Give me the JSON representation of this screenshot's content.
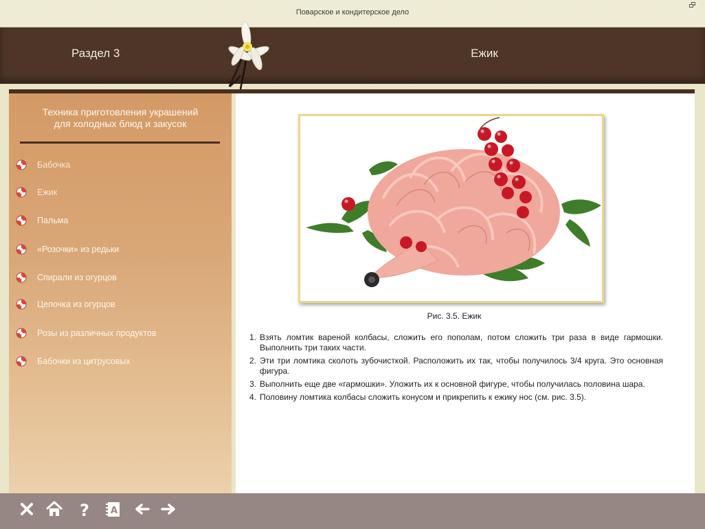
{
  "window": {
    "title": "Поварское и кондитерское дело"
  },
  "header": {
    "section_label": "Раздел 3",
    "topic_title": "Ежик"
  },
  "sidebar": {
    "heading_line1": "Техника приготовления украшений",
    "heading_line2": "для холодных блюд и закусок",
    "items": [
      {
        "label": "Бабочка",
        "light": true
      },
      {
        "label": "Ежик",
        "light": true
      },
      {
        "label": "Пальма",
        "light": false
      },
      {
        "label": "«Розочки» из редьки",
        "light": false
      },
      {
        "label": "Спирали из огурцов",
        "light": false
      },
      {
        "label": "Цепочка из огурцов",
        "light": false
      },
      {
        "label": "Розы из различных продуктов",
        "light": false
      },
      {
        "label": "Бабочки из цитрусовых",
        "light": false
      }
    ]
  },
  "content": {
    "figure_caption": "Рис. 3.5. Ежик",
    "steps": [
      {
        "num": "1.",
        "text": "Взять ломтик вареной колбасы, сложить его пополам, потом сложить три раза в виде гармошки. Выполнить три таких части."
      },
      {
        "num": "2.",
        "text": "Эти три ломтика сколоть зубочисткой. Расположить их так, чтобы получилось 3/4 круга. Это основная фигура."
      },
      {
        "num": "3.",
        "text": "Выполнить еще две «гармошки». Уложить их к основной фигуре, чтобы получилась половина шара."
      },
      {
        "num": "4.",
        "text": "Половину ломтика колбасы сложить конусом и прикрепить к ежику нос (см. рис. 3.5)."
      }
    ]
  },
  "toolbar": {
    "buttons": [
      {
        "icon": "close-icon"
      },
      {
        "icon": "home-icon"
      },
      {
        "icon": "help-icon"
      },
      {
        "icon": "glossary-icon"
      },
      {
        "icon": "arrow-left-icon"
      },
      {
        "icon": "arrow-right-icon"
      }
    ]
  },
  "colors": {
    "header_brown": "#4b3326",
    "accent_band": "#4a2e1f",
    "sidebar_top": "#d39a66",
    "sidebar_bottom": "#ecd0ac",
    "footer_gray": "#968784",
    "frame_gold": "#ecd68c"
  }
}
